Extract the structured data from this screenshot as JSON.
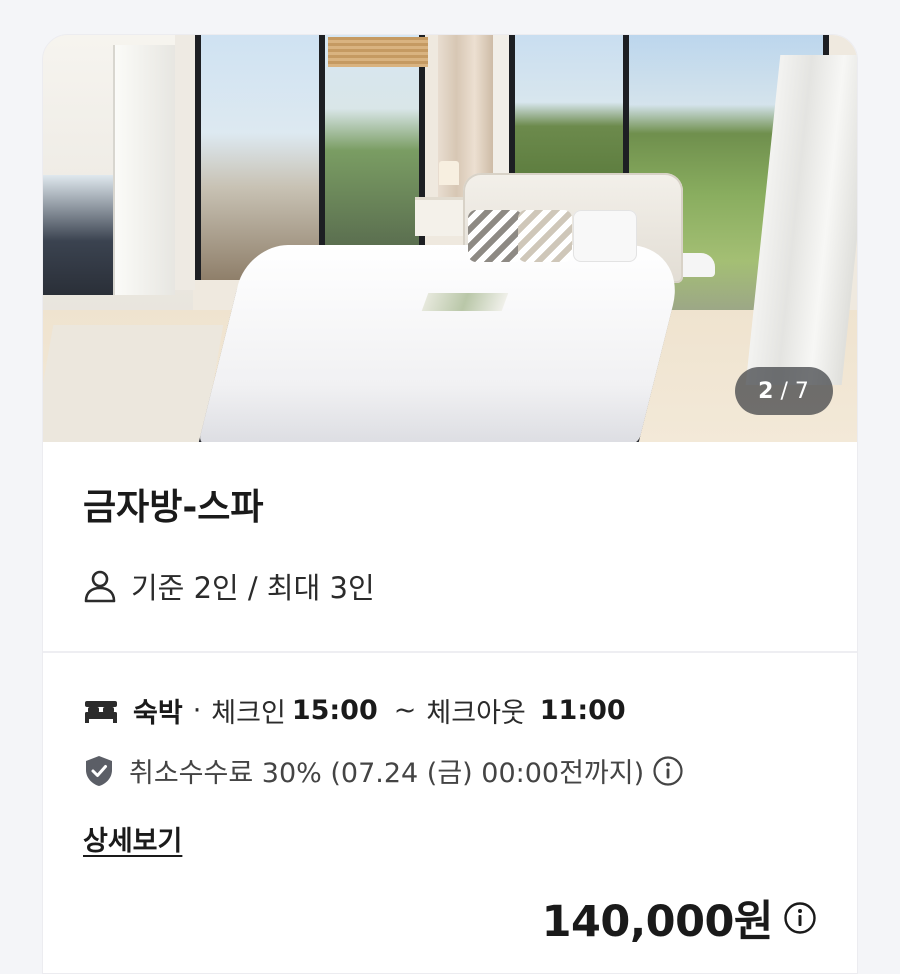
{
  "room": {
    "name": "금자방-스파",
    "photo_counter": {
      "current": "2",
      "separator": "/",
      "total": "7"
    },
    "capacity_text": "기준 2인 / 최대 3인"
  },
  "stay": {
    "type": "숙박",
    "bullet": "·",
    "checkin_label": "체크인",
    "checkin_time": "15:00",
    "tilde": "~",
    "checkout_label": "체크아웃",
    "checkout_time": "11:00"
  },
  "cancellation": {
    "text": "취소수수료 30% (07.24 (금) 00:00전까지)"
  },
  "detail_link": "상세보기",
  "price": {
    "amount": "140,000원"
  },
  "icons": {
    "capacity": "person-icon",
    "stay": "bed-icon",
    "cancellation": "shield-icon",
    "cancellation_info": "info-icon",
    "price_info": "info-icon"
  },
  "colors": {
    "text": "#1a1a1a",
    "secondary_text": "#444444",
    "icon_gray": "#5b5e66",
    "counter_bg": "rgba(60,62,66,0.72)"
  }
}
